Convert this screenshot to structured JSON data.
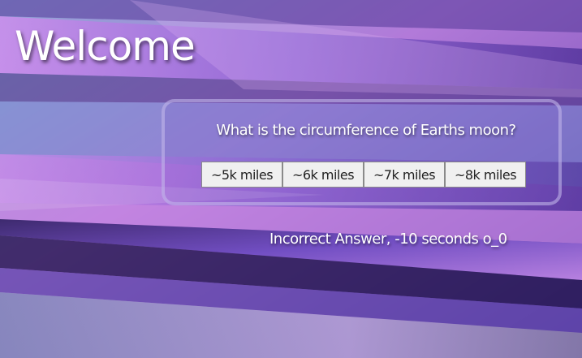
{
  "page": {
    "title": "Welcome"
  },
  "quiz": {
    "question": "What is the circumference of Earths moon?",
    "answers": [
      "~5k miles",
      "~6k miles",
      "~7k miles",
      "~8k miles"
    ],
    "feedback": "Incorrect Answer, -10 seconds o_0"
  },
  "colors": {
    "background_accent": "#7a5ab8",
    "text": "#ffffff",
    "button_bg": "#f0f0f0"
  }
}
